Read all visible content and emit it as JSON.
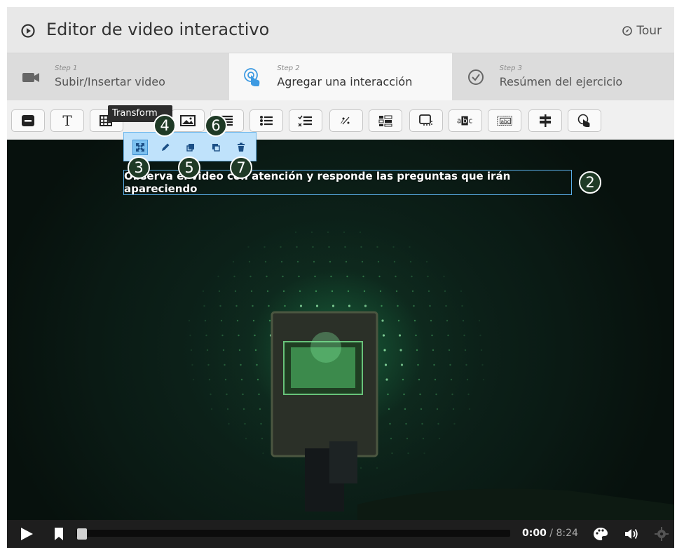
{
  "header": {
    "title": "Editor de video interactivo",
    "tour_label": "Tour"
  },
  "steps": [
    {
      "small": "Step 1",
      "label": "Subir/Insertar video",
      "icon": "video-camera-icon"
    },
    {
      "small": "Step 2",
      "label": "Agregar una interacción",
      "icon": "touch-pointer-icon"
    },
    {
      "small": "Step 3",
      "label": "Resúmen del ejercicio",
      "icon": "check-circle-icon"
    }
  ],
  "toolbar": {
    "items": [
      "label-icon",
      "text-icon",
      "table-icon",
      "image-icon",
      "statements-icon",
      "multiple-choice-icon",
      "checklist-icon",
      "fill-blanks-icon",
      "drag-drop-icon",
      "summary-icon",
      "mark-words-icon",
      "drag-text-icon",
      "crossroads-icon",
      "navigation-hotspot-icon"
    ],
    "text_glyph": "T",
    "tooltip": "Transform"
  },
  "interaction_toolbar": [
    "move-icon",
    "pencil-icon",
    "bring-front-icon",
    "send-back-icon",
    "trash-icon"
  ],
  "callouts": [
    "2",
    "3",
    "4",
    "5",
    "6",
    "7"
  ],
  "text_interaction": "Observa el video con atención y responde las preguntas que irán apareciendo",
  "player": {
    "current": "0:00",
    "separator": " / ",
    "total": "8:24"
  },
  "colors": {
    "accent": "#5aaee8",
    "toolbar_selection": "#bfe2fb",
    "header": "#e8e8e8",
    "player_bar": "#1e1e1e"
  }
}
